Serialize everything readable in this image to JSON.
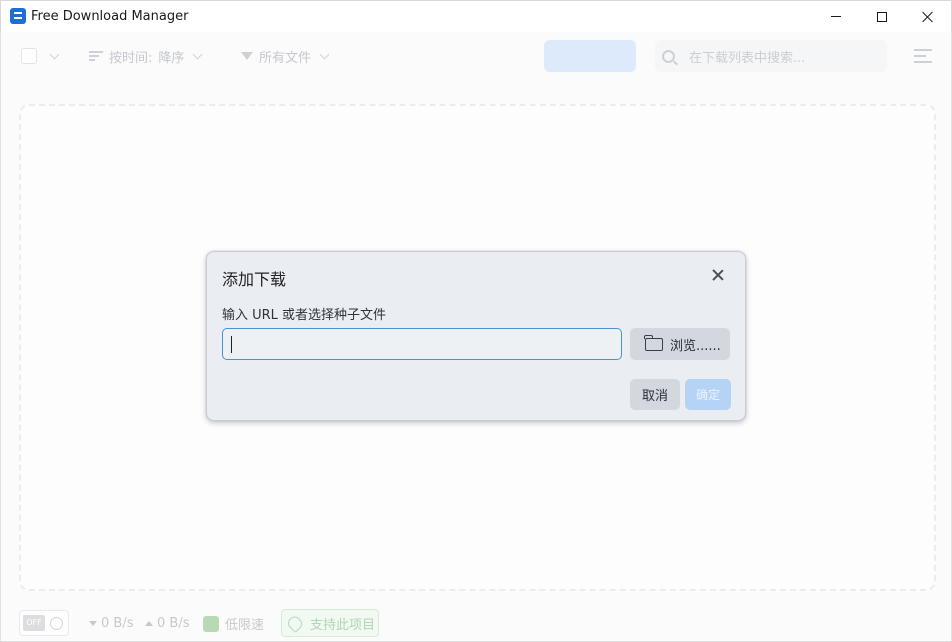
{
  "window": {
    "title": "Free Download Manager"
  },
  "toolbar": {
    "sort_label": "按时间:",
    "sort_value": "降序",
    "filter_label": "所有文件",
    "search_placeholder": "在下载列表中搜索..."
  },
  "statusbar": {
    "toggle_label": "OFF",
    "download_speed": "0 B/s",
    "upload_speed": "0 B/s",
    "low_speed_label": "低限速",
    "support_label": "支持此项目"
  },
  "dialog": {
    "title": "添加下载",
    "prompt": "输入 URL 或者选择种子文件",
    "url_value": "",
    "browse_label": "浏览......",
    "cancel_label": "取消",
    "ok_label": "确定"
  },
  "colors": {
    "accent": "#4d8fd6",
    "ok_button": "#b5d3f5",
    "support_green": "#9fcda3"
  }
}
